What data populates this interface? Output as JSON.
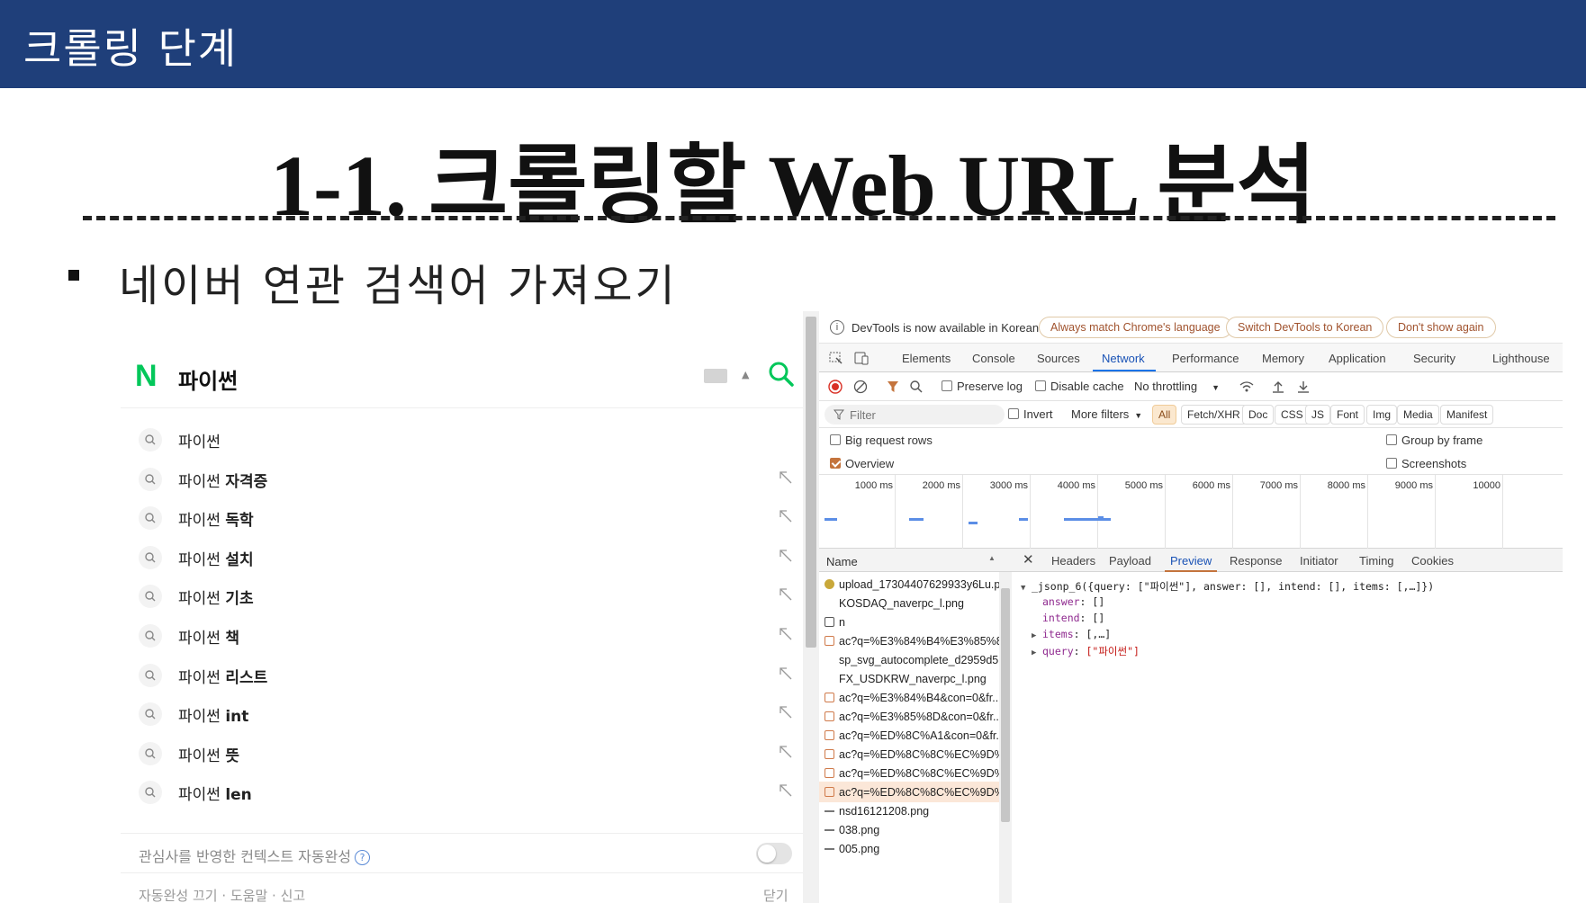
{
  "slide": {
    "header": "크롤링 단계",
    "title": "1-1. 크롤링할 Web URL 분석",
    "bullet": "네이버 연관 검색어 가져오기"
  },
  "naver": {
    "logo": "N",
    "query": "파이썬",
    "suggestions": [
      {
        "prefix": "파이썬",
        "suffix": ""
      },
      {
        "prefix": "파이썬 ",
        "suffix": "자격증"
      },
      {
        "prefix": "파이썬 ",
        "suffix": "독학"
      },
      {
        "prefix": "파이썬 ",
        "suffix": "설치"
      },
      {
        "prefix": "파이썬 ",
        "suffix": "기초"
      },
      {
        "prefix": "파이썬 ",
        "suffix": "책"
      },
      {
        "prefix": "파이썬 ",
        "suffix": "리스트"
      },
      {
        "prefix": "파이썬 ",
        "suffix": "int"
      },
      {
        "prefix": "파이썬 ",
        "suffix": "뜻"
      },
      {
        "prefix": "파이썬 ",
        "suffix": "len"
      }
    ],
    "context_label": "관심사를 반영한 컨텍스트 자동완성",
    "context_help": "?",
    "footer_links": "자동완성 끄기 · 도움말 · 신고",
    "footer_close": "닫기",
    "brand_color": "#03c75a"
  },
  "devtools": {
    "info_message": "DevTools is now available in Korean!",
    "info_buttons": [
      "Always match Chrome's language",
      "Switch DevTools to Korean",
      "Don't show again"
    ],
    "tabs": [
      "Elements",
      "Console",
      "Sources",
      "Network",
      "Performance",
      "Memory",
      "Application",
      "Security",
      "Lighthouse"
    ],
    "active_tab": "Network",
    "toolbar": {
      "preserve_log": "Preserve log",
      "disable_cache": "Disable cache",
      "throttling": "No throttling"
    },
    "filter": {
      "placeholder": "Filter",
      "invert": "Invert",
      "more_filters": "More filters",
      "types": [
        "All",
        "Fetch/XHR",
        "Doc",
        "CSS",
        "JS",
        "Font",
        "Img",
        "Media",
        "Manifest"
      ],
      "active_type": "All"
    },
    "options": {
      "big_request_rows": "Big request rows",
      "overview": "Overview",
      "group_by_frame": "Group by frame",
      "screenshots": "Screenshots"
    },
    "timeline_labels": [
      "1000 ms",
      "2000 ms",
      "3000 ms",
      "4000 ms",
      "5000 ms",
      "6000 ms",
      "7000 ms",
      "8000 ms",
      "9000 ms",
      "10000"
    ],
    "requests_header": "Name",
    "requests": [
      "upload_17304407629933y6Lu.p...",
      "KOSDAQ_naverpc_l.png",
      "n",
      "ac?q=%E3%84%B4%E3%85%8...",
      "sp_svg_autocomplete_d2959d5...",
      "FX_USDKRW_naverpc_l.png",
      "ac?q=%E3%84%B4&con=0&fr...",
      "ac?q=%E3%85%8D&con=0&fr...",
      "ac?q=%ED%8C%A1&con=0&fr...",
      "ac?q=%ED%8C%8C%EC%9D%...",
      "ac?q=%ED%8C%8C%EC%9D%...",
      "ac?q=%ED%8C%8C%EC%9D%...",
      "nsd16121208.png",
      "038.png",
      "005.png"
    ],
    "detail_tabs": [
      "Headers",
      "Payload",
      "Preview",
      "Response",
      "Initiator",
      "Timing",
      "Cookies"
    ],
    "active_detail_tab": "Preview",
    "preview": {
      "line1": "_jsonp_6({query: [\"파이썬\"], answer: [], intend: [], items: [,…]})",
      "answer_key": "answer",
      "answer_val": "[]",
      "intend_key": "intend",
      "intend_val": "[]",
      "items_key": "items",
      "items_val": "[,…]",
      "query_key": "query",
      "query_val": "[\"파이썬\"]"
    }
  }
}
